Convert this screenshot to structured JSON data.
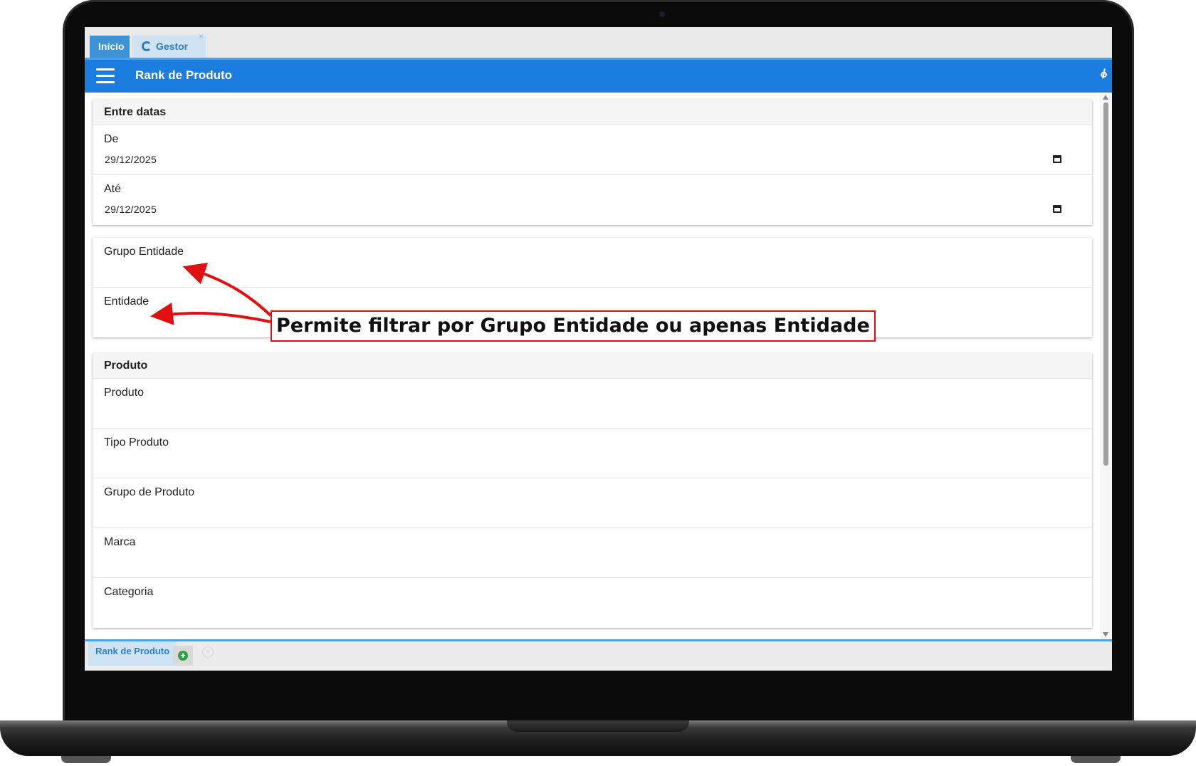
{
  "tabs": [
    {
      "label": "Início"
    },
    {
      "label": "Gestor",
      "close": "×"
    }
  ],
  "header": {
    "title": "Rank de Produto",
    "code_icon": "‹/›"
  },
  "sections": {
    "datas": {
      "title": "Entre datas",
      "fields": [
        {
          "label": "De",
          "value": "29/12/2025"
        },
        {
          "label": "Até",
          "value": "29/12/2025"
        }
      ]
    },
    "entidade": {
      "fields": [
        {
          "label": "Grupo Entidade"
        },
        {
          "label": "Entidade"
        }
      ]
    },
    "produto": {
      "title": "Produto",
      "fields": [
        {
          "label": "Produto"
        },
        {
          "label": "Tipo Produto"
        },
        {
          "label": "Grupo de Produto"
        },
        {
          "label": "Marca"
        },
        {
          "label": "Categoria"
        }
      ]
    }
  },
  "bottom": {
    "tab_label": "Rank de Produto",
    "add": "+",
    "close": "×"
  },
  "annotation": {
    "text": "Permite filtrar por Grupo Entidade ou apenas Entidade"
  },
  "colors": {
    "header": "#1b7de0",
    "callout_border": "#e01010",
    "arrow": "#e01010"
  }
}
